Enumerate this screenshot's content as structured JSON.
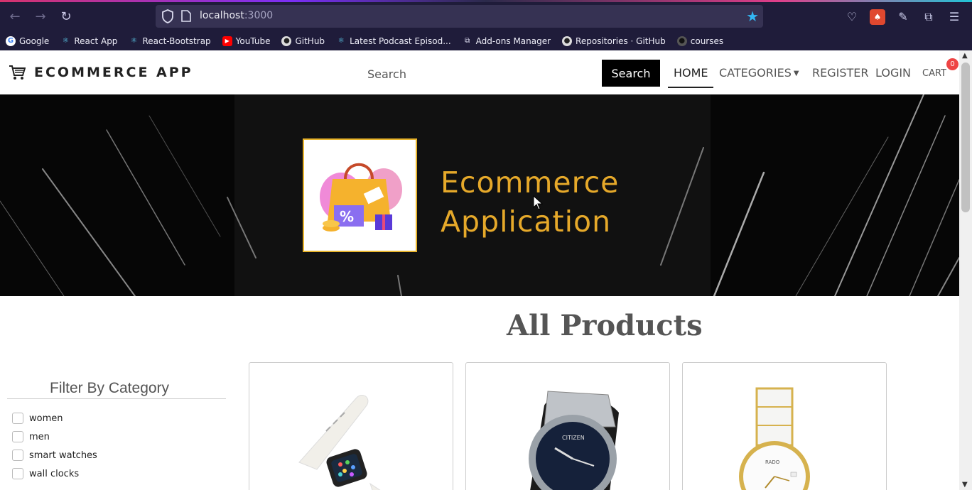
{
  "browser": {
    "url_host": "localhost",
    "url_port": ":3000",
    "bookmarks": [
      {
        "label": "Google",
        "icon": "google-icon"
      },
      {
        "label": "React App",
        "icon": "react-icon"
      },
      {
        "label": "React-Bootstrap",
        "icon": "react-icon"
      },
      {
        "label": "YouTube",
        "icon": "youtube-icon"
      },
      {
        "label": "GitHub",
        "icon": "github-icon"
      },
      {
        "label": "Latest Podcast Episod...",
        "icon": "podcast-icon"
      },
      {
        "label": "Add-ons Manager",
        "icon": "puzzle-icon"
      },
      {
        "label": "Repositories · GitHub",
        "icon": "github-icon"
      },
      {
        "label": "courses",
        "icon": "user-icon"
      }
    ]
  },
  "navbar": {
    "brand": "ECOMMERCE APP",
    "search_placeholder": "Search",
    "search_button": "Search",
    "links": {
      "home": "HOME",
      "categories": "CATEGORIES",
      "register": "REGISTER",
      "login": "LOGIN",
      "cart": "CART"
    },
    "cart_count": "0"
  },
  "banner": {
    "title_line1": "Ecommerce",
    "title_line2": "Application"
  },
  "products": {
    "title": "All Products"
  },
  "filter": {
    "title": "Filter By Category",
    "categories": [
      "women",
      "men",
      "smart watches",
      "wall clocks"
    ]
  },
  "colors": {
    "banner_text": "#e6a92a",
    "browser_chrome": "#1f1c3a",
    "cart_badge": "#ee4444"
  }
}
